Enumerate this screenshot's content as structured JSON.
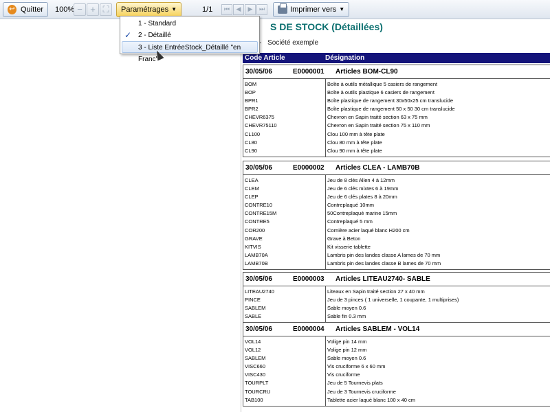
{
  "toolbar": {
    "quit_label": "Quitter",
    "zoom": "100%",
    "zoom_out": "−",
    "zoom_in": "+",
    "param_label": "Paramétrages",
    "page": "1/1",
    "print_label": "Imprimer vers"
  },
  "menu": {
    "items": [
      {
        "label": "1 - Standard"
      },
      {
        "label": "2 - Détaillé"
      },
      {
        "label": "3 - Liste EntréeStock_Détaillé \"en Franc\""
      }
    ]
  },
  "report": {
    "title_partial": "S DE STOCK (Détaillées)",
    "company_prefix": "-",
    "company": "Société exemple",
    "col_code": "Code Article",
    "col_designation": "Désignation",
    "entries": [
      {
        "date": "30/05/06",
        "num": "E0000001",
        "articles": "Articles BOM-CL90",
        "codes": [
          "BOM",
          "BOP",
          "BPR1",
          "BPR2",
          "CHEVR6375",
          "CHEVR75110",
          "CL100",
          "CL80",
          "CL90"
        ],
        "descs": [
          "Boîte à outils métallique 5 casiers de rangement",
          "Boîte à outils plastique 6 casiers de rangement",
          "Boîte plastique de rangement 30x50x25 cm translucide",
          "Boîte plastique de rangement 50 x 50 30 cm translucide",
          "Chevron en Sapin traité section 63 x 75 mm",
          "Chevron en Sapin traité section 75 x 110 mm",
          "Clou 100 mm à tête plate",
          "Clou 80 mm à tête plate",
          "Clou 90 mm à tête plate"
        ]
      },
      {
        "date": "30/05/06",
        "num": "E0000002",
        "articles": "Articles CLEA - LAMB70B",
        "codes": [
          "CLEA",
          "CLEM",
          "CLEP",
          "CONTRE10",
          "CONTRE15M",
          "CONTRE5",
          "COR200",
          "GRAVE",
          "KITVIS",
          "LAMB70A",
          "LAMB70B"
        ],
        "descs": [
          "Jeu de 8 clés Allen 4 à 12mm",
          "Jeu de 6 clés mixtes 6 à 19mm",
          "Jeu de 6 clés plates 8 à 20mm",
          "Contreplaqué 10mm",
          "50Contreplaqué marine 15mm",
          "Contreplaqué 5 mm",
          "Cornière acier laqué blanc H200 cm",
          "Grave à Beton",
          "Kit visserie tablette",
          "Lambris pin des landes classe A lames de 70 mm",
          "Lambris pin des landes classe B lames de 70 mm"
        ]
      },
      {
        "date": "30/05/06",
        "num": "E0000003",
        "articles": "Articles LITEAU2740- SABLE",
        "codes": [
          "LITEAU2740",
          "PINCE",
          "SABLEM",
          "SABLE"
        ],
        "descs": [
          "Liteaux en Sapin traité section 27 x 40 mm",
          "Jeu de 3 pinces ( 1 universelle, 1 coupante, 1 multiprises)",
          "Sable moyen 0.6",
          "Sable fin 0.3 mm"
        ]
      },
      {
        "date": "30/05/06",
        "num": "E0000004",
        "articles": "Articles SABLEM - VOL14",
        "codes": [
          "VOL14",
          "VOL12",
          "SABLEM",
          "VISC660",
          "VISC430",
          "TOURPLT",
          "TOURCRU",
          "TAB100"
        ],
        "descs": [
          "Volige pin 14 mm",
          "Volige pin 12 mm",
          "Sable moyen 0.6",
          "Vis cruciforme 6 x 60 mm",
          "Vis cruciforme",
          "Jeu de 5 Tournevis plats",
          "Jeu de 3 Tournevis cruciforme",
          "Tablette acier laqué blanc 100 x 40 cm"
        ]
      }
    ]
  }
}
